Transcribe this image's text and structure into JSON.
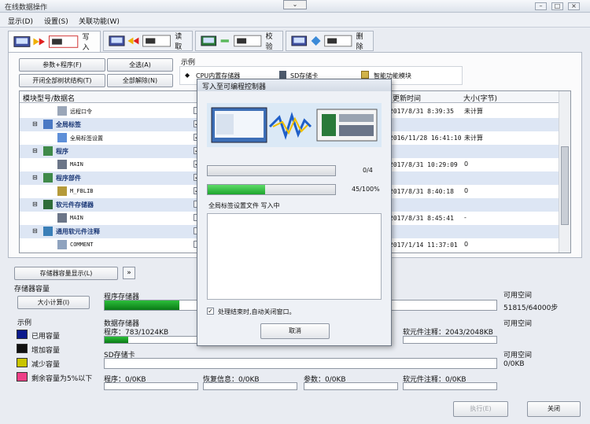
{
  "window": {
    "title": "在线数据操作",
    "topbtn": "⌄"
  },
  "menu": [
    "显示(D)",
    "设置(S)",
    "关联功能(W)"
  ],
  "tabs": [
    {
      "label": "写入",
      "active": true
    },
    {
      "label": "读取",
      "active": false
    },
    {
      "label": "校验",
      "active": false
    },
    {
      "label": "删除",
      "active": false
    }
  ],
  "buttons": {
    "param_program": "参数+程序(F)",
    "select_all": "全选(A)",
    "open_all": "开闭全部树状结构(T)",
    "deselect_all": "全部解除(N)",
    "capacity_display": "存储器容量显示(L)",
    "calc_size": "大小计算(I)",
    "execute": "执行(E)",
    "close": "关闭"
  },
  "legend_top": {
    "label": "示例",
    "items": [
      "CPU内置存储器",
      "SD存储卡",
      "智能功能模块"
    ]
  },
  "table": {
    "headers": [
      "模块型号/数据名",
      "更新时间",
      "大小(字节)"
    ],
    "rows": [
      {
        "name": "远程口令",
        "group": false,
        "checked": "",
        "time": "2017/8/31 8:39:35",
        "size": "未计算"
      },
      {
        "name": "全局标签",
        "group": true,
        "checked": "✓",
        "time": "",
        "size": ""
      },
      {
        "name": "全局标签设置",
        "group": false,
        "checked": "✓",
        "time": "2016/11/28 16:41:10",
        "size": "未计算"
      },
      {
        "name": "程序",
        "group": true,
        "checked": "✓",
        "time": "",
        "size": ""
      },
      {
        "name": "MAIN",
        "group": false,
        "checked": "✓",
        "time": "2017/8/31 10:29:09",
        "size": "0"
      },
      {
        "name": "程序部件",
        "group": true,
        "checked": "✓",
        "time": "",
        "size": ""
      },
      {
        "name": "M_FBLIB",
        "group": false,
        "checked": "✓",
        "time": "2017/8/31 8:40:18",
        "size": "0"
      },
      {
        "name": "软元件存储器",
        "group": true,
        "checked": "",
        "time": "",
        "size": ""
      },
      {
        "name": "MAIN",
        "group": false,
        "checked": "",
        "time": "2017/8/31 8:45:41",
        "size": "-"
      },
      {
        "name": "通用软元件注释",
        "group": true,
        "checked": "",
        "time": "",
        "size": ""
      },
      {
        "name": "COMMENT",
        "group": false,
        "checked": "",
        "time": "2017/1/14 11:37:01",
        "size": "0"
      }
    ]
  },
  "capacity": {
    "title": "存储器容量",
    "program_mem": "程序存储器",
    "free_space": "可用空间",
    "free_value": "51815/64000步",
    "data_mem": "数据存储器",
    "program_line": "程序：783/1024KB",
    "device_comment": "软元件注释：2043/2048KB",
    "free_space2": "可用空间",
    "sd_card": "SD存储卡",
    "free_space3": "可用空间",
    "sd_free": "0/0KB",
    "sd_program": "程序：0/0KB",
    "sd_restore": "恢复信息：0/0KB",
    "sd_param": "参数：0/0KB",
    "sd_comment": "软元件注释：0/0KB"
  },
  "legend_bottom": {
    "label": "示例",
    "items": [
      {
        "label": "已用容量",
        "color": "#0b1a8c"
      },
      {
        "label": "增加容量",
        "color": "#111111"
      },
      {
        "label": "减少容量",
        "color": "#c9c400"
      },
      {
        "label": "剩余容量为5%以下",
        "color": "#ee3f87"
      }
    ]
  },
  "dialog": {
    "title": "写入至可编程控制器",
    "progress1_text": "0/4",
    "progress1": 0.0,
    "progress2_text": "45/100%",
    "progress2": 0.45,
    "status": "全局标签设置文件 写入中",
    "auto_close": "处理结束时,自动关闭窗口。",
    "cancel": "取消"
  }
}
